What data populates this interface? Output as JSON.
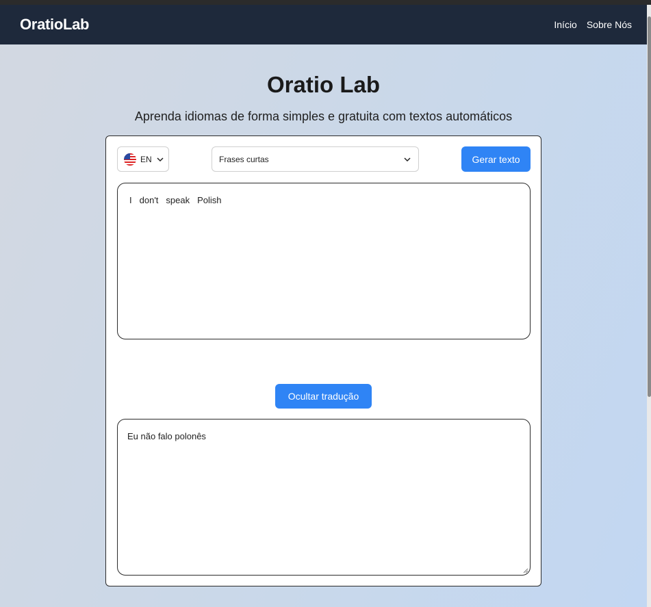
{
  "nav": {
    "brand": "OratioLab",
    "links": [
      "Início",
      "Sobre Nós"
    ]
  },
  "hero": {
    "title": "Oratio Lab",
    "subtitle": "Aprenda idiomas de forma simples e gratuita com textos automáticos"
  },
  "controls": {
    "language": {
      "code": "EN",
      "flag_icon": "us-flag-icon"
    },
    "mode": {
      "selected": "Frases curtas"
    },
    "generate_label": "Gerar texto"
  },
  "source_text": {
    "words": [
      "I",
      "don't",
      "speak",
      "Polish"
    ]
  },
  "toggle_translation_label": "Ocultar tradução",
  "translation_text": "Eu não falo polonês",
  "colors": {
    "navbar": "#1e293b",
    "accent": "#2f84f5"
  }
}
